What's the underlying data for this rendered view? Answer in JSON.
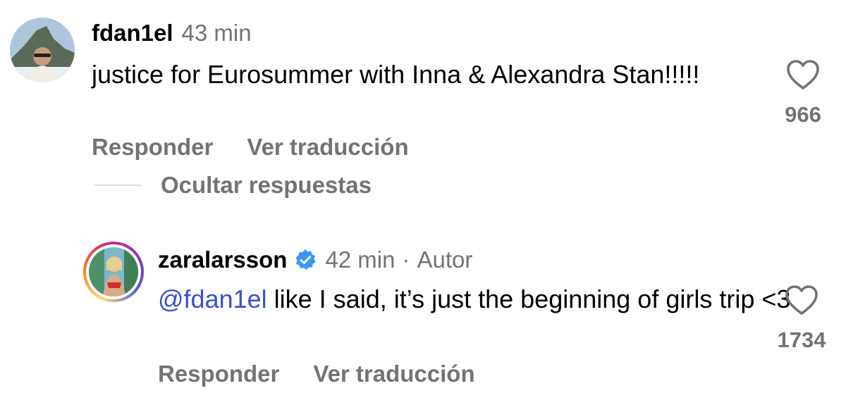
{
  "comments": [
    {
      "username": "fdan1el",
      "time": "43 min",
      "text": "justice for Eurosummer with Inna & Alexandra Stan!!!!!",
      "likes": "966",
      "reply_label": "Responder",
      "translate_label": "Ver traducción"
    },
    {
      "username": "zaralarsson",
      "verified": true,
      "time": "42 min",
      "author_badge": "Autor",
      "mention": "@fdan1el",
      "text": " like I said, it’s just the beginning of girls trip <3",
      "likes": "1734",
      "reply_label": "Responder",
      "translate_label": "Ver traducción"
    }
  ],
  "hide_replies_label": "Ocultar respuestas",
  "colors": {
    "secondary_text": "#737373",
    "mention": "#3b4fcf",
    "verified": "#3897f0"
  },
  "icons": [
    "heart-outline-icon",
    "verified-badge-icon"
  ]
}
